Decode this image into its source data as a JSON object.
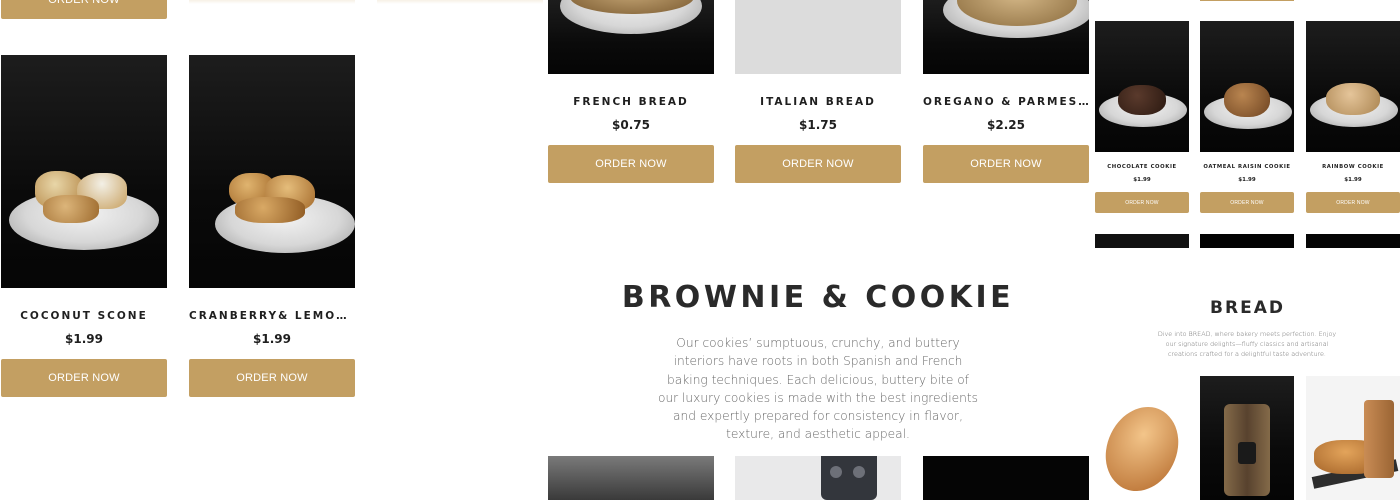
{
  "scones": {
    "top_button": "ORDER NOW",
    "items": [
      {
        "name": "COCONUT SCONE",
        "price": "$1.99",
        "button": "ORDER NOW"
      },
      {
        "name": "CRANBERRY& LEMON SC...",
        "price": "$1.99",
        "button": "ORDER NOW"
      }
    ]
  },
  "breads": {
    "items": [
      {
        "name": "FRENCH BREAD",
        "price": "$0.75",
        "button": "ORDER NOW"
      },
      {
        "name": "ITALIAN BREAD",
        "price": "$1.75",
        "button": "ORDER NOW"
      },
      {
        "name": "OREGANO & PARMESAN ...",
        "price": "$2.25",
        "button": "ORDER NOW"
      }
    ]
  },
  "brownie_section": {
    "title": "BROWNIE & COOKIE",
    "description": "Our cookies’ sumptuous, crunchy, and buttery interiors have roots in both Spanish and French baking techniques. Each delicious, buttery bite of our luxury cookies is made with the best ingredients and expertly prepared for consistency in flavor, texture, and aesthetic appeal."
  },
  "mini_cookies": {
    "items": [
      {
        "name": "CHOCOLATE COOKIE",
        "price": "$1.99",
        "button": "ORDER NOW"
      },
      {
        "name": "OATMEAL RAISIN COOKIE",
        "price": "$1.99",
        "button": "ORDER NOW"
      },
      {
        "name": "RAINBOW COOKIE",
        "price": "$1.99",
        "button": "ORDER NOW"
      }
    ]
  },
  "mini_bread_section": {
    "title": "BREAD",
    "description": "Dive into BREAD, where bakery meets perfection. Enjoy our signature delights—fluffy classics and artisanal creations crafted for a delightful taste adventure."
  },
  "colors": {
    "accent": "#c39f62",
    "text": "#1f1f1f",
    "muted": "#6a6a6a"
  }
}
